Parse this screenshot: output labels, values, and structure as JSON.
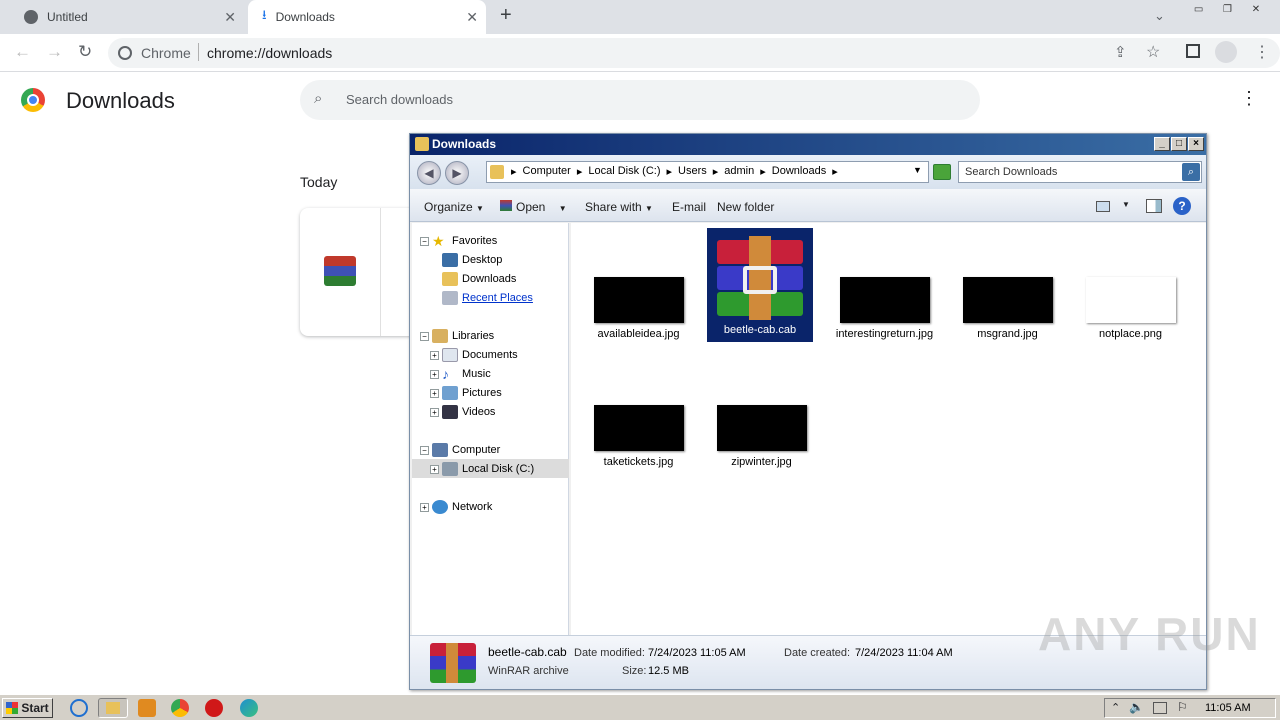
{
  "browser": {
    "tabs": [
      {
        "label": "Untitled",
        "icon": "globe-icon"
      },
      {
        "label": "Downloads",
        "icon": "download-icon"
      }
    ],
    "new_tab": "+",
    "omnibox": {
      "site": "Chrome",
      "url": "chrome://downloads"
    }
  },
  "downloads_page": {
    "title": "Downloads",
    "search_placeholder": "Search downloads",
    "section_today": "Today"
  },
  "explorer": {
    "title": "Downloads",
    "breadcrumb": [
      "Computer",
      "Local Disk (C:)",
      "Users",
      "admin",
      "Downloads"
    ],
    "search_placeholder": "Search Downloads",
    "commands": [
      "Organize",
      "Open",
      "Share with",
      "E-mail",
      "New folder"
    ],
    "nav": {
      "favorites": "Favorites",
      "favorites_items": [
        "Desktop",
        "Downloads",
        "Recent Places"
      ],
      "libraries": "Libraries",
      "libraries_items": [
        "Documents",
        "Music",
        "Pictures",
        "Videos"
      ],
      "computer": "Computer",
      "local_disk": "Local Disk (C:)",
      "network": "Network"
    },
    "files": [
      {
        "name": "availableidea.jpg"
      },
      {
        "name": "beetle-cab.cab",
        "selected": true
      },
      {
        "name": "interestingreturn.jpg"
      },
      {
        "name": "msgrand.jpg"
      },
      {
        "name": "notplace.png"
      },
      {
        "name": "taketickets.jpg"
      },
      {
        "name": "zipwinter.jpg"
      }
    ],
    "details": {
      "name": "beetle-cab.cab",
      "type": "WinRAR archive",
      "modified_label": "Date modified:",
      "modified": "7/24/2023 11:05 AM",
      "created_label": "Date created:",
      "created": "7/24/2023 11:04 AM",
      "size_label": "Size:",
      "size": "12.5 MB"
    }
  },
  "taskbar": {
    "start": "Start",
    "clock": "11:05 AM"
  },
  "watermark": "ANY RUN",
  "colors": {
    "accent": "#1a73e8",
    "selection": "#0a246a"
  }
}
